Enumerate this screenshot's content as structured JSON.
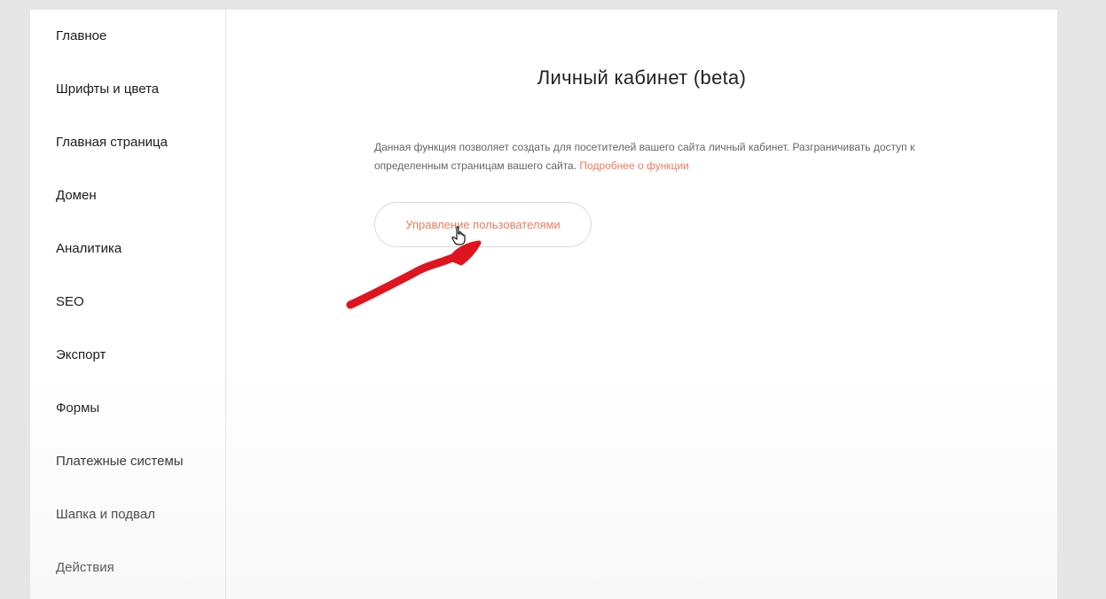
{
  "sidebar": {
    "items": [
      {
        "label": "Главное"
      },
      {
        "label": "Шрифты и цвета"
      },
      {
        "label": "Главная страница"
      },
      {
        "label": "Домен"
      },
      {
        "label": "Аналитика"
      },
      {
        "label": "SEO"
      },
      {
        "label": "Экспорт"
      },
      {
        "label": "Формы"
      },
      {
        "label": "Платежные системы"
      },
      {
        "label": "Шапка и подвал"
      },
      {
        "label": "Действия"
      }
    ]
  },
  "main": {
    "title": "Личный кабинет (beta)",
    "description": "Данная функция позволяет создать для посетителей вашего сайта личный кабинет. Разграничивать доступ к определенным страницам вашего сайта.",
    "more_link": "Подробнее о функции",
    "manage_button": "Управление пользователями"
  },
  "colors": {
    "accent": "#f07c5a",
    "annotation": "#e0141e"
  },
  "icons": {
    "cursor": "hand-pointer-icon",
    "annotation": "red-arrow-annotation"
  }
}
